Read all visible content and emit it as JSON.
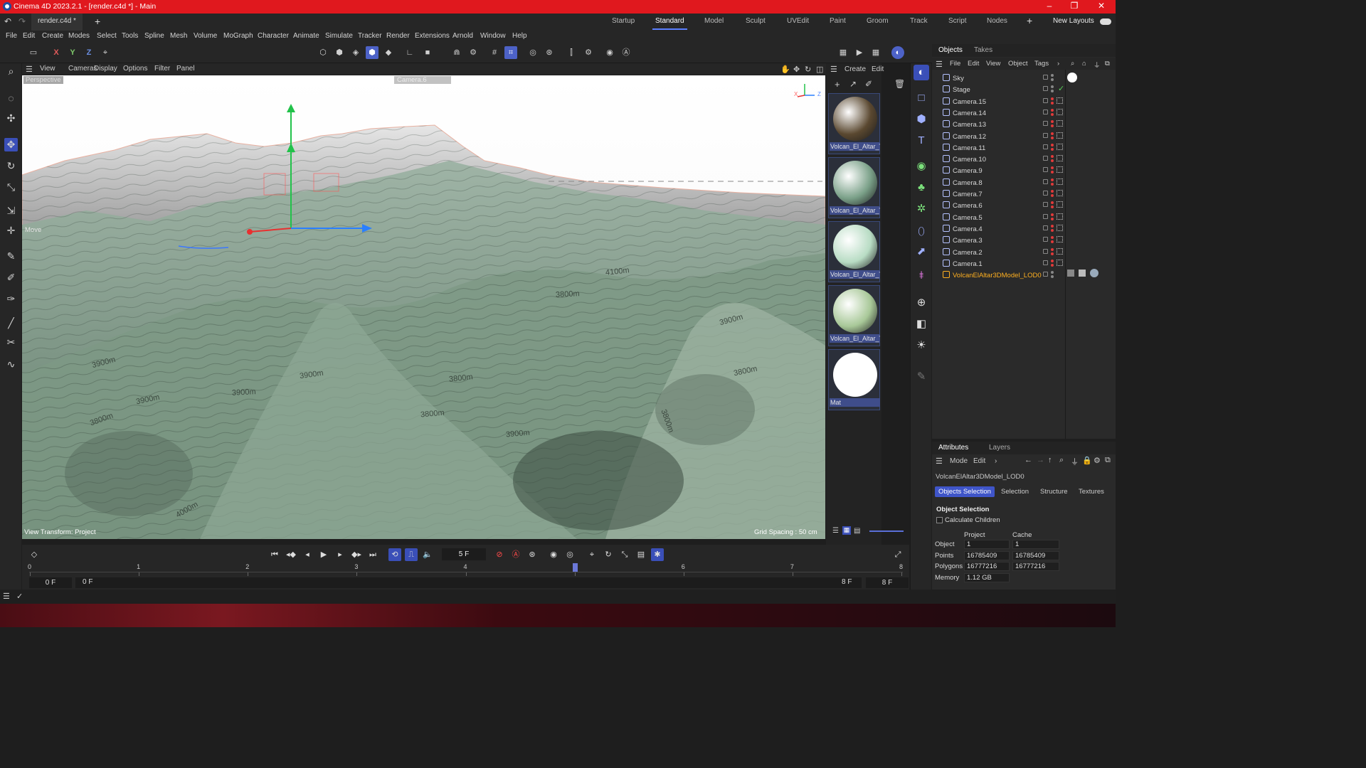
{
  "app": {
    "title": "Cinema 4D 2023.2.1 - [render.c4d *] - Main",
    "window_controls": [
      "–",
      "❐",
      "✕"
    ]
  },
  "doc_tab": "render.c4d *",
  "layouts": [
    "Startup",
    "Standard",
    "Model",
    "Sculpt",
    "UVEdit",
    "Paint",
    "Groom",
    "Track",
    "Script",
    "Nodes"
  ],
  "layout_active": "Standard",
  "new_layouts": "New Layouts",
  "menu": [
    "File",
    "Edit",
    "Create",
    "Modes",
    "Select",
    "Tools",
    "Spline",
    "Mesh",
    "Volume",
    "MoGraph",
    "Character",
    "Animate",
    "Simulate",
    "Tracker",
    "Render",
    "Extensions",
    "Arnold",
    "Window",
    "Help"
  ],
  "axis_buttons": [
    "X",
    "Y",
    "Z"
  ],
  "viewport_menu": [
    "View",
    "Cameras",
    "Display",
    "Options",
    "Filter",
    "Panel"
  ],
  "viewport": {
    "camera_label": "Perspective",
    "camera_name": "Camera.6",
    "tool_label": "Move",
    "view_transform": "View Transform: Project",
    "grid_spacing": "Grid Spacing : 50 cm",
    "contour_labels": [
      "3900m",
      "3800m",
      "3900m",
      "3900m",
      "3800m",
      "3800m",
      "3900m",
      "3800m",
      "4100m",
      "3900m",
      "3800m",
      "3900m",
      "3800m",
      "4000m"
    ],
    "axis_gizmo": {
      "x": "X",
      "y": "Y",
      "z": "Z"
    }
  },
  "material_menu": [
    "Create",
    "Edit"
  ],
  "materials": [
    {
      "label": "Volcan_El_Altar_Te",
      "color": "#5a4830"
    },
    {
      "label": "Volcan_El_Altar_Te",
      "color": "#7aa088"
    },
    {
      "label": "Volcan_El_Altar_Te",
      "color": "#b8dcc4"
    },
    {
      "label": "Volcan_El_Altar_Te",
      "color": "#a8c898"
    },
    {
      "label": "Mat",
      "color": "#ffffff"
    }
  ],
  "objects_panel": {
    "tabs": [
      "Objects",
      "Takes"
    ],
    "active_tab": "Objects",
    "menu": [
      "File",
      "Edit",
      "View",
      "Object",
      "Tags"
    ],
    "items": [
      {
        "name": "Sky",
        "selected": false
      },
      {
        "name": "Stage",
        "selected": false
      },
      {
        "name": "Camera.15",
        "selected": false
      },
      {
        "name": "Camera.14",
        "selected": false
      },
      {
        "name": "Camera.13",
        "selected": false
      },
      {
        "name": "Camera.12",
        "selected": false
      },
      {
        "name": "Camera.11",
        "selected": false
      },
      {
        "name": "Camera.10",
        "selected": false
      },
      {
        "name": "Camera.9",
        "selected": false
      },
      {
        "name": "Camera.8",
        "selected": false
      },
      {
        "name": "Camera.7",
        "selected": false
      },
      {
        "name": "Camera.6",
        "selected": false
      },
      {
        "name": "Camera.5",
        "selected": false
      },
      {
        "name": "Camera.4",
        "selected": false
      },
      {
        "name": "Camera.3",
        "selected": false
      },
      {
        "name": "Camera.2",
        "selected": false
      },
      {
        "name": "Camera.1",
        "selected": false
      },
      {
        "name": "VolcanElAltar3DModel_LOD0",
        "selected": true
      }
    ]
  },
  "attributes": {
    "tabs": [
      "Attributes",
      "Layers"
    ],
    "active_tab": "Attributes",
    "menu": [
      "Mode",
      "Edit"
    ],
    "object_name": "VolcanElAltar3DModel_LOD0",
    "buttons": [
      "Objects Selection",
      "Selection",
      "Structure",
      "Textures"
    ],
    "active_button": "Objects Selection",
    "section": "Object Selection",
    "calculate_children": "Calculate Children",
    "col_project": "Project",
    "col_cache": "Cache",
    "rows": [
      {
        "label": "Object",
        "project": "1",
        "cache": "1"
      },
      {
        "label": "Points",
        "project": "16785409",
        "cache": "16785409"
      },
      {
        "label": "Polygons",
        "project": "16777216",
        "cache": "16777216"
      },
      {
        "label": "Memory",
        "project": "1.12 GB",
        "cache": ""
      }
    ]
  },
  "timeline": {
    "current_frame": "5 F",
    "start_frame": "0 F",
    "start_frame2": "0 F",
    "end_frame": "8 F",
    "end_frame2": "8 F",
    "ticks": [
      "0",
      "1",
      "2",
      "3",
      "4",
      "5",
      "6",
      "7",
      "8"
    ],
    "playhead_frame": 5
  },
  "colors": {
    "titlebar": "#e0181e",
    "accent": "#4d62c7",
    "terrain": "#7f9a86"
  }
}
